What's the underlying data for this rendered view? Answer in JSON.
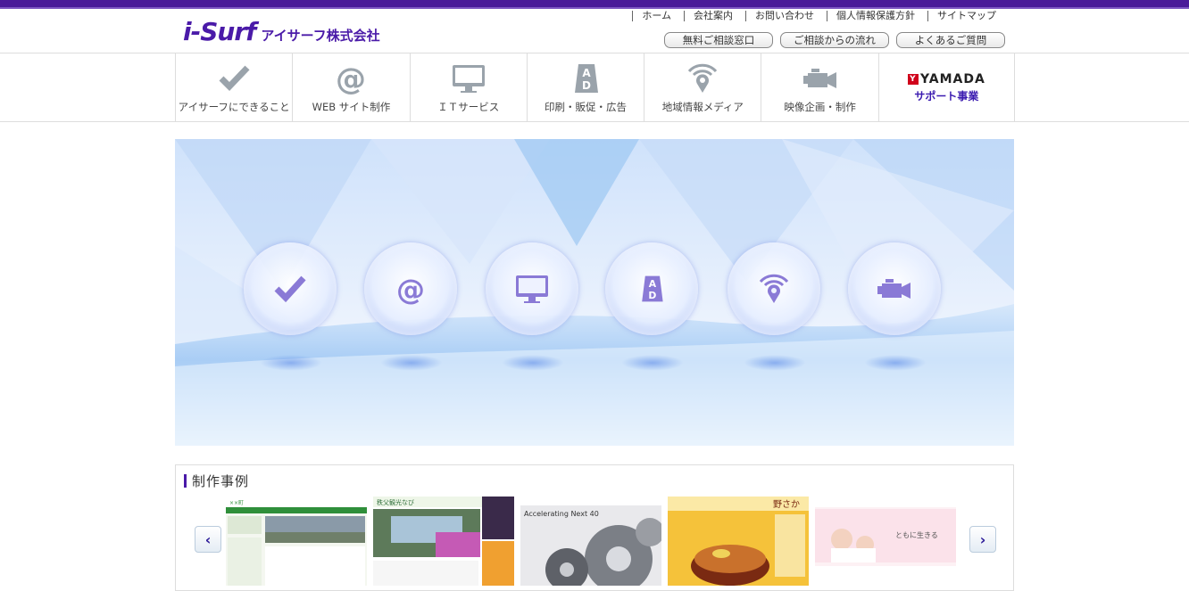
{
  "brand": {
    "logo_mark": "i-Surf",
    "logo_text": "アイサーフ株式会社"
  },
  "top_links": [
    "ホーム",
    "会社案内",
    "お問い合わせ",
    "個人情報保護方針",
    "サイトマップ"
  ],
  "header_buttons": [
    "無料ご相談窓口",
    "ご相談からの流れ",
    "よくあるご質問"
  ],
  "nav": [
    {
      "label": "アイサーフにできること",
      "icon": "check-icon"
    },
    {
      "label": "WEB サイト制作",
      "icon": "at-icon"
    },
    {
      "label": "ＩＴサービス",
      "icon": "monitor-icon"
    },
    {
      "label": "印刷・販促・広告",
      "icon": "ad-board-icon"
    },
    {
      "label": "地域情報メディア",
      "icon": "location-signal-icon"
    },
    {
      "label": "映像企画・制作",
      "icon": "video-camera-icon"
    }
  ],
  "yamada": {
    "logo": "YAMADA",
    "sub": "サポート事業"
  },
  "works": {
    "title": "制作事例",
    "thumbs": [
      {
        "name": "thumb-town",
        "caption": "××町"
      },
      {
        "name": "thumb-chichibu",
        "caption": "秩父観光なび"
      },
      {
        "name": "thumb-gears",
        "caption": "Accelerating Next 40"
      },
      {
        "name": "thumb-restaurant",
        "caption": "野さか"
      },
      {
        "name": "thumb-care",
        "caption": "ともに生きる"
      }
    ]
  },
  "colors": {
    "brand_purple": "#4a1aa8",
    "icon_purple": "#8a7ad6",
    "nav_icon_gray": "#9aa3ab"
  }
}
